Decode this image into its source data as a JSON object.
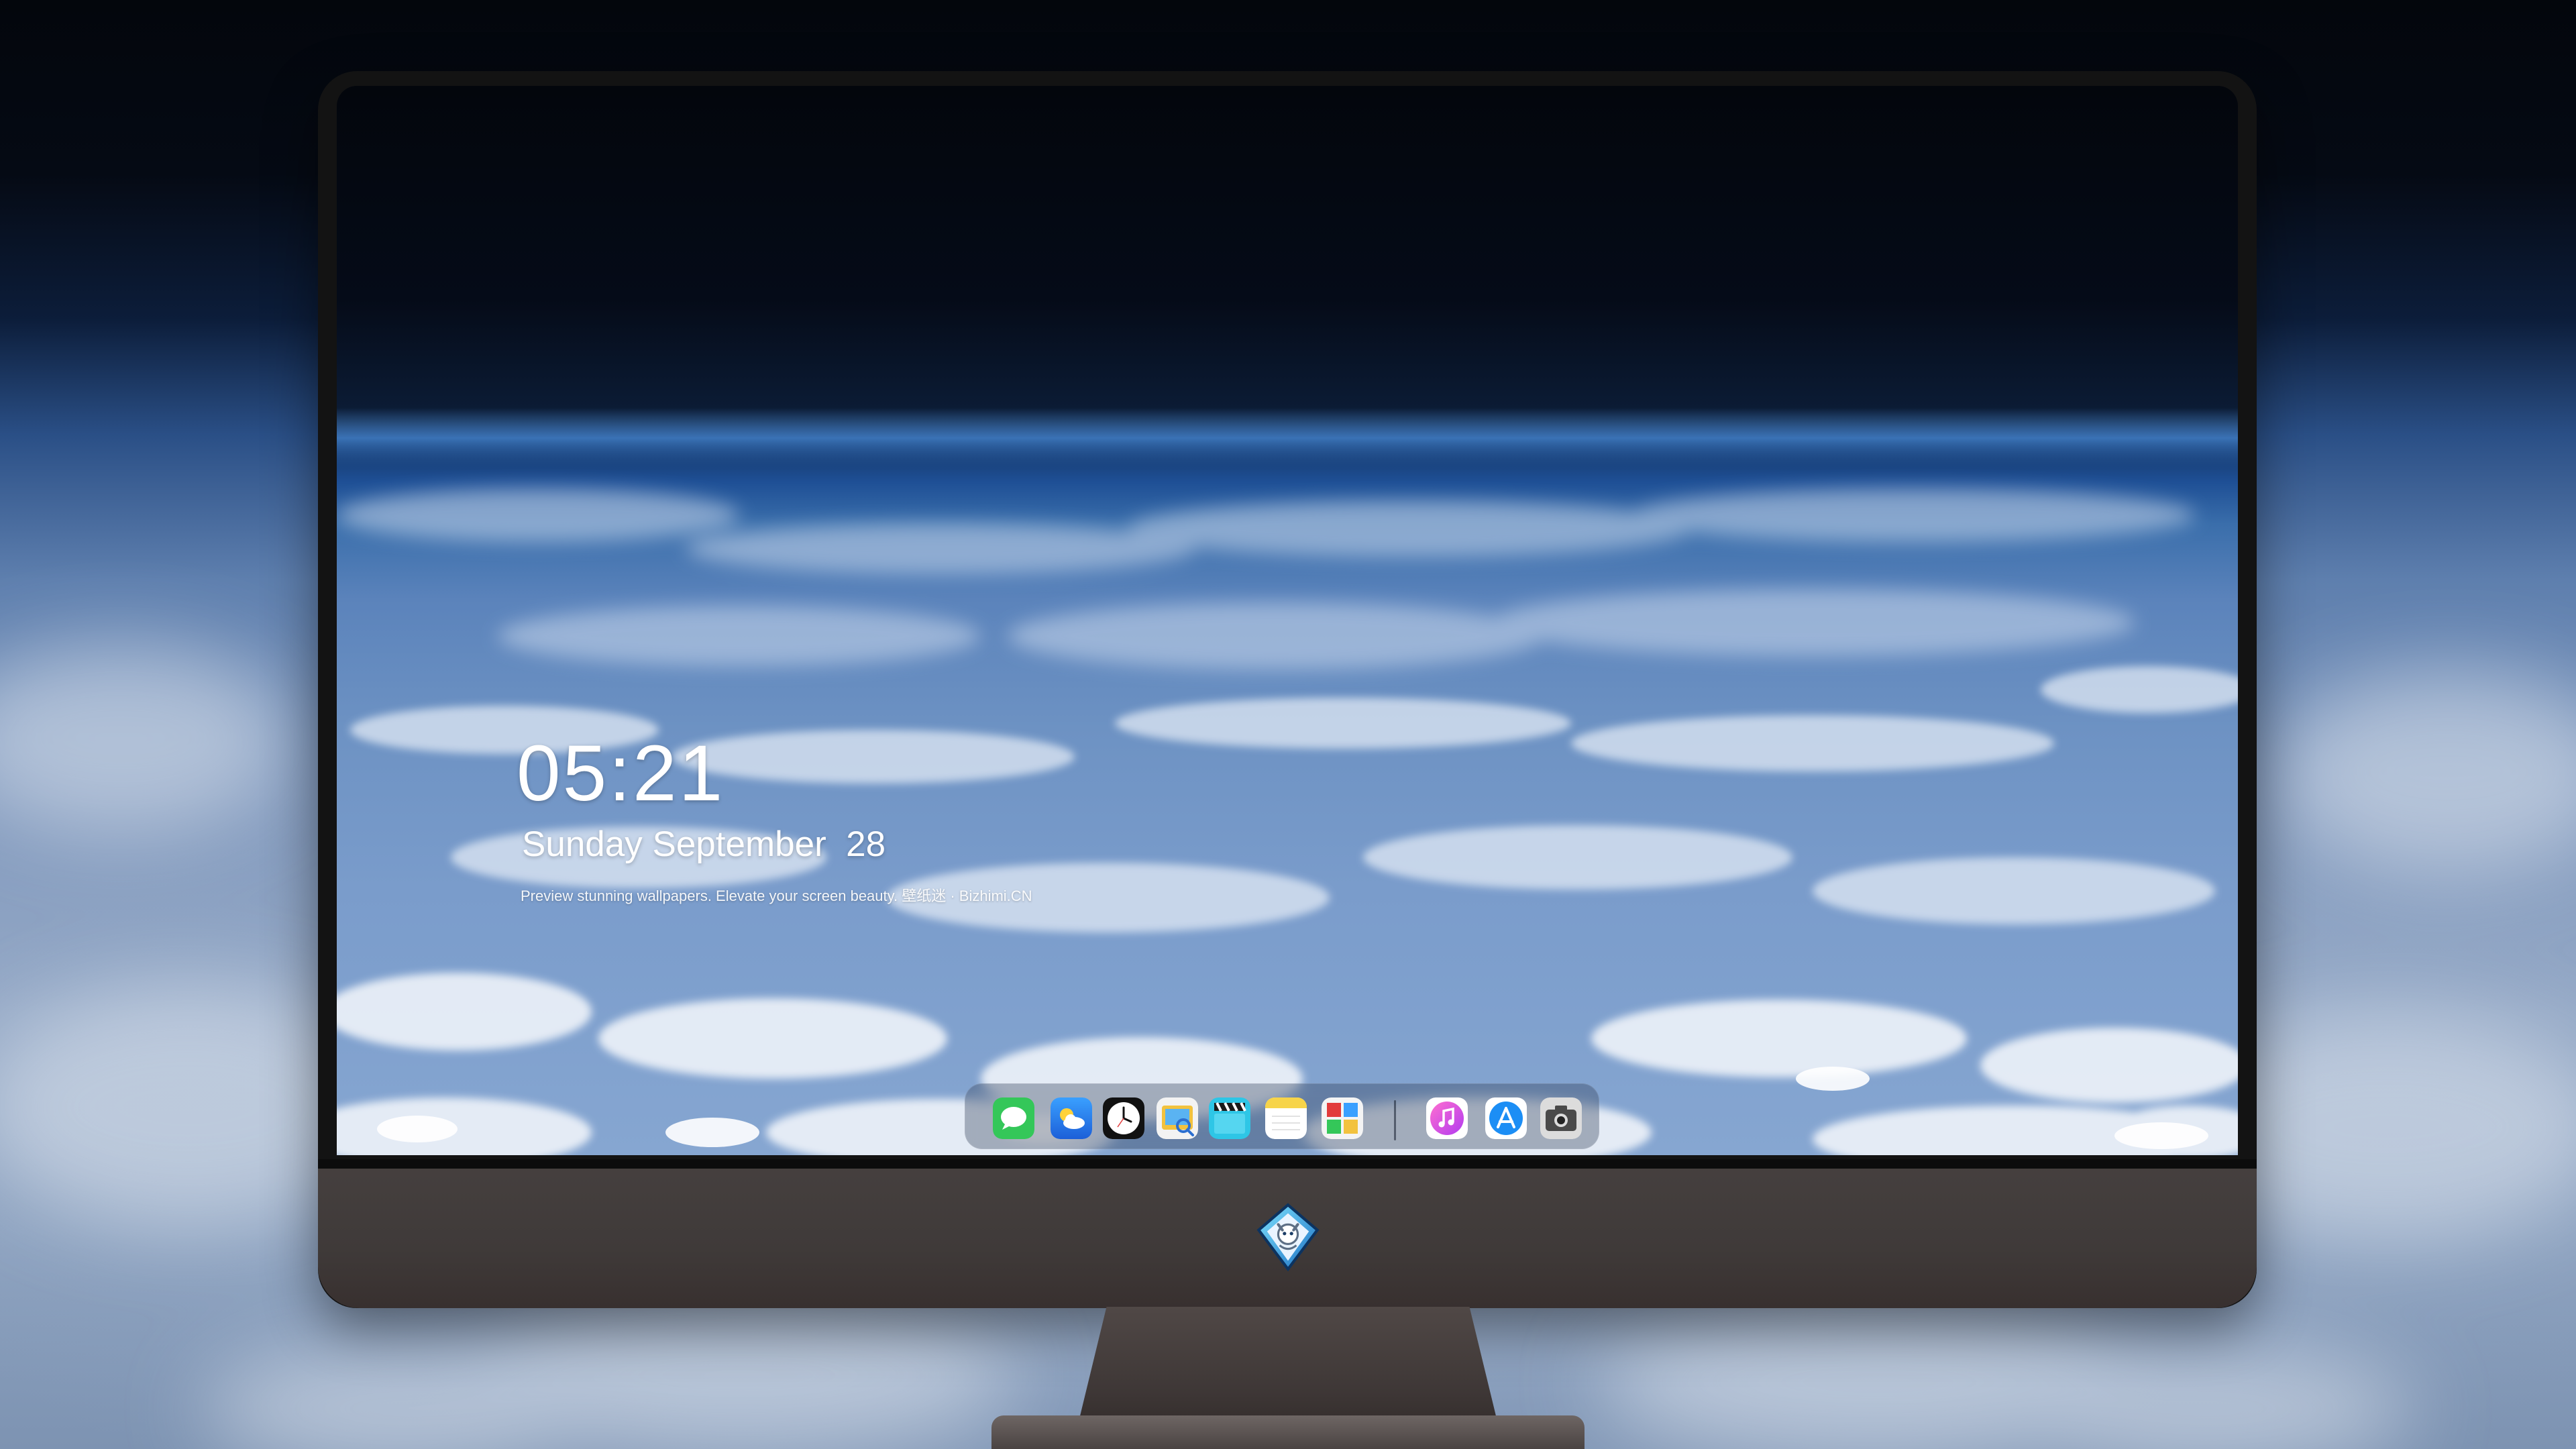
{
  "lockscreen": {
    "time": "05:21",
    "date": "Sunday September  28",
    "tagline": "Preview stunning wallpapers. Elevate your screen beauty. 壁纸迷 · Bizhimi.CN"
  },
  "dock": {
    "apps": [
      {
        "name": "Messages",
        "icon": "messages-icon",
        "color": "#33c25a"
      },
      {
        "name": "Weather",
        "icon": "weather-icon",
        "color": "#2a8cf0"
      },
      {
        "name": "Clock",
        "icon": "clock-icon",
        "color": "#111111"
      },
      {
        "name": "Preview",
        "icon": "preview-icon",
        "color": "#f2c23e"
      },
      {
        "name": "Clips",
        "icon": "clips-icon",
        "color": "#2ec6e6"
      },
      {
        "name": "Notes",
        "icon": "notes-icon",
        "color": "#f7d44a"
      },
      {
        "name": "Photo Booth",
        "icon": "photo-booth-icon",
        "color": "#e23b3b"
      },
      {
        "name": "iTunes",
        "icon": "itunes-icon",
        "color": "#e94fd8"
      },
      {
        "name": "App Store",
        "icon": "app-store-icon",
        "color": "#1c8ef5"
      },
      {
        "name": "Camera",
        "icon": "camera-icon",
        "color": "#5a5a5a"
      }
    ]
  },
  "brand_logo": "dragon-shield-logo"
}
